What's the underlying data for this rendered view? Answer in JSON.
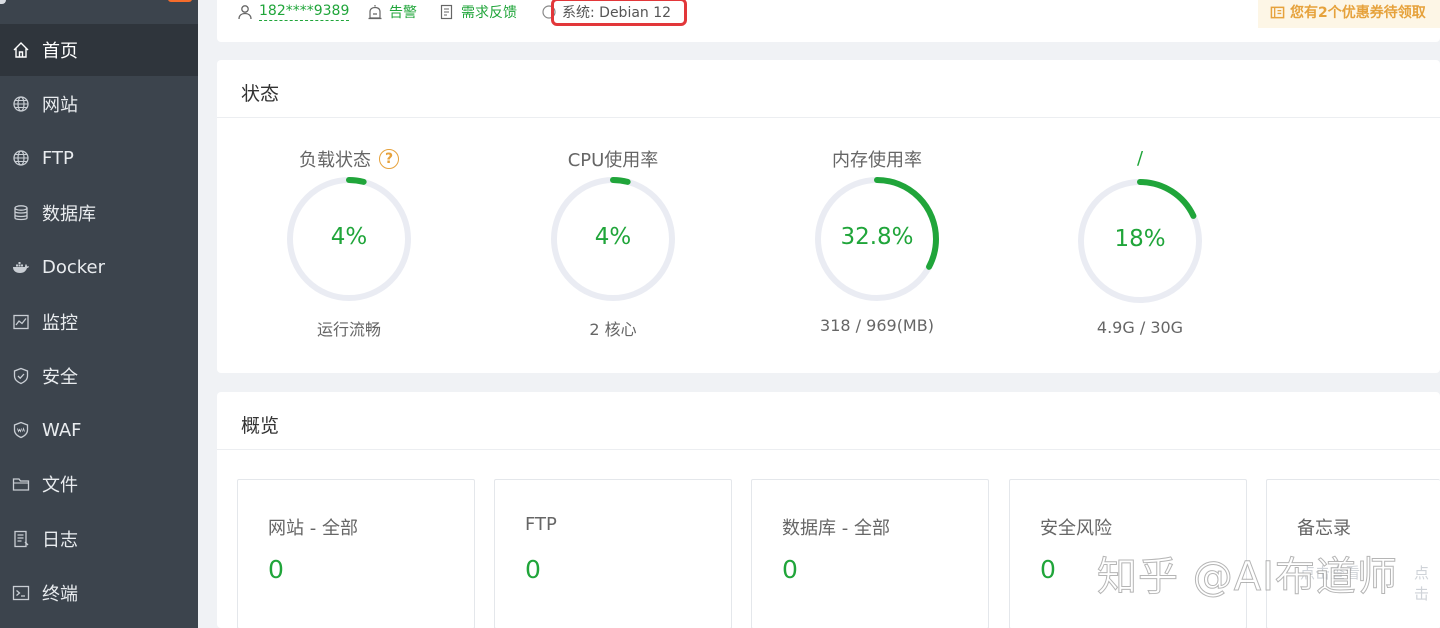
{
  "colors": {
    "accent": "#20a53a",
    "sidebar_bg": "#3c444d",
    "sidebar_active": "#2f353c",
    "warning": "#e6a23c",
    "highlight_red": "#e2373a"
  },
  "sidebar": {
    "items": [
      {
        "label": "首页",
        "icon": "home-icon"
      },
      {
        "label": "网站",
        "icon": "globe-icon"
      },
      {
        "label": "FTP",
        "icon": "globe-icon"
      },
      {
        "label": "数据库",
        "icon": "database-icon"
      },
      {
        "label": "Docker",
        "icon": "docker-icon"
      },
      {
        "label": "监控",
        "icon": "monitor-icon"
      },
      {
        "label": "安全",
        "icon": "shield-icon"
      },
      {
        "label": "WAF",
        "icon": "waf-shield-icon"
      },
      {
        "label": "文件",
        "icon": "folder-icon"
      },
      {
        "label": "日志",
        "icon": "log-icon"
      },
      {
        "label": "终端",
        "icon": "terminal-icon"
      }
    ],
    "active_index": 0
  },
  "topbar": {
    "user": "182****9389",
    "alert": "告警",
    "feedback": "需求反馈",
    "system": "系统: Debian 12",
    "coupon": "您有2个优惠券待领取"
  },
  "status": {
    "title": "状态",
    "gauges": [
      {
        "label": "负载状态",
        "value": "4%",
        "percent": 4,
        "sub": "运行流畅",
        "help": "?"
      },
      {
        "label": "CPU使用率",
        "value": "4%",
        "percent": 4,
        "sub": "2 核心"
      },
      {
        "label": "内存使用率",
        "value": "32.8%",
        "percent": 32.8,
        "sub": "318 / 969(MB)"
      },
      {
        "label": "/",
        "value": "18%",
        "percent": 18,
        "sub": "4.9G / 30G"
      }
    ]
  },
  "overview": {
    "title": "概览",
    "boxes": [
      {
        "title": "网站 - 全部",
        "value": "0"
      },
      {
        "title": "FTP",
        "value": "0"
      },
      {
        "title": "数据库 - 全部",
        "value": "0"
      },
      {
        "title": "安全风险",
        "value": "0"
      },
      {
        "title": "备忘录",
        "value": ""
      }
    ]
  },
  "watermark": {
    "text": "知乎 @AI布道师",
    "faint1": "点击查看",
    "faint2": "点击"
  }
}
